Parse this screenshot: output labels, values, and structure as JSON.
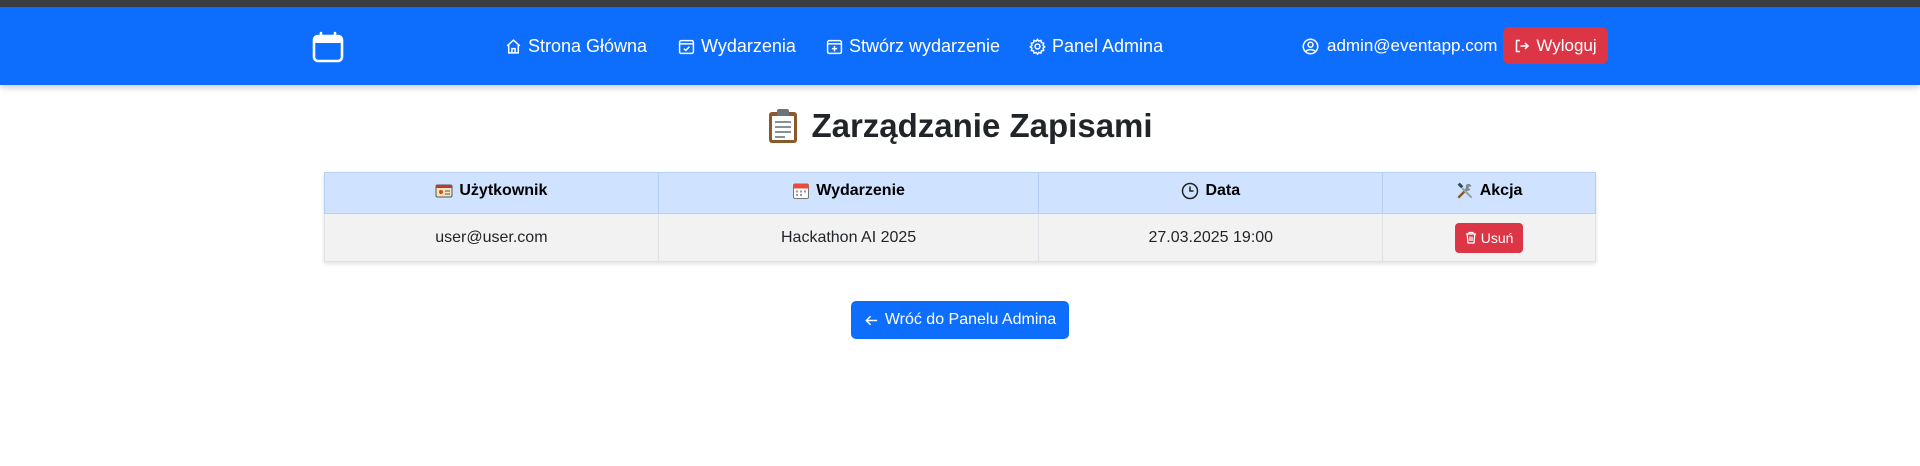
{
  "nav": {
    "brand_icon": "calendar-icon",
    "links": [
      {
        "label": "Strona Główna",
        "icon": "house-icon"
      },
      {
        "label": "Wydarzenia",
        "icon": "calendar-check-icon"
      },
      {
        "label": "Stwórz wydarzenie",
        "icon": "calendar-plus-icon"
      },
      {
        "label": "Panel Admina",
        "icon": "gear-icon"
      }
    ],
    "user_email": "admin@eventapp.com",
    "logout_label": "Wyloguj"
  },
  "page": {
    "title": "Zarządzanie Zapisami",
    "title_icon": "clipboard-icon"
  },
  "table": {
    "headers": [
      "Użytkownik",
      "Wydarzenie",
      "Data",
      "Akcja"
    ],
    "rows": [
      {
        "user": "user@user.com",
        "event": "Hackathon AI 2025",
        "date": "27.03.2025 19:00",
        "action_label": "Usuń"
      }
    ]
  },
  "back_button": {
    "label": "Wróć do Panelu Admina"
  },
  "colors": {
    "primary": "#0d6efd",
    "danger": "#dc3545",
    "header_bg": "#cfe2ff"
  }
}
